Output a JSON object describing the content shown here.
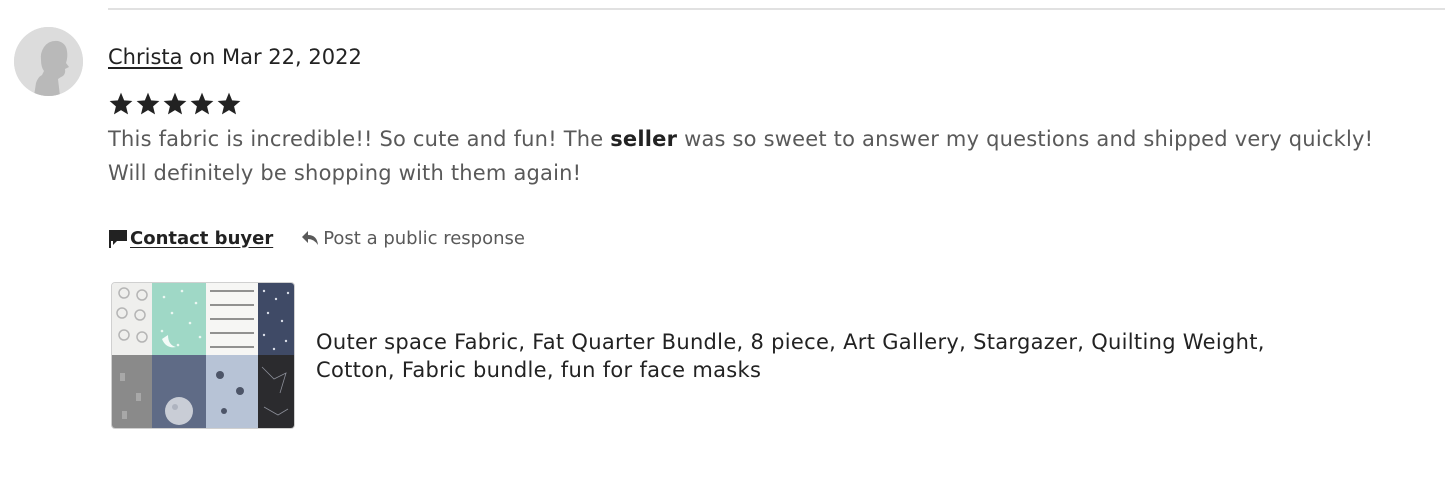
{
  "review": {
    "reviewer_name": "Christa",
    "date_text": "on Mar 22, 2022",
    "rating": 5,
    "rating_max": 5,
    "text_before": "This fabric is incredible!! So cute and fun! The ",
    "text_bold": "seller",
    "text_after": " was so sweet to answer my questions and shipped very quickly! Will definitely be shopping with them again!"
  },
  "actions": {
    "contact_label": "Contact buyer",
    "respond_label": "Post a public response"
  },
  "product": {
    "title": "Outer space Fabric, Fat Quarter Bundle, 8 piece, Art Gallery, Stargazer, Quilting Weight, Cotton, Fabric bundle, fun for face masks"
  },
  "icons": {
    "avatar": "person-silhouette-icon",
    "star": "star-icon",
    "contact": "chat-flag-icon",
    "respond": "reply-arrow-icon"
  },
  "colors": {
    "star": "#222222",
    "body_text": "#595959",
    "divider": "#e1e1e1"
  }
}
